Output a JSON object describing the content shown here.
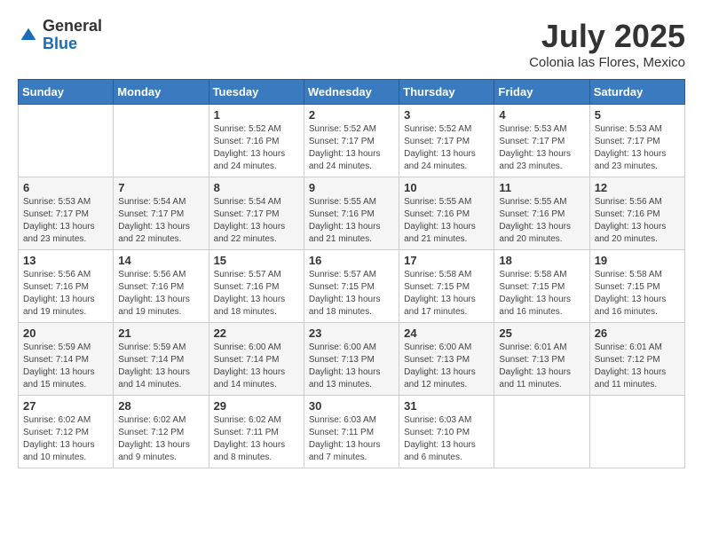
{
  "logo": {
    "general": "General",
    "blue": "Blue"
  },
  "title": "July 2025",
  "subtitle": "Colonia las Flores, Mexico",
  "days_of_week": [
    "Sunday",
    "Monday",
    "Tuesday",
    "Wednesday",
    "Thursday",
    "Friday",
    "Saturday"
  ],
  "weeks": [
    [
      {
        "day": "",
        "content": ""
      },
      {
        "day": "",
        "content": ""
      },
      {
        "day": "1",
        "content": "Sunrise: 5:52 AM\nSunset: 7:16 PM\nDaylight: 13 hours and 24 minutes."
      },
      {
        "day": "2",
        "content": "Sunrise: 5:52 AM\nSunset: 7:17 PM\nDaylight: 13 hours and 24 minutes."
      },
      {
        "day": "3",
        "content": "Sunrise: 5:52 AM\nSunset: 7:17 PM\nDaylight: 13 hours and 24 minutes."
      },
      {
        "day": "4",
        "content": "Sunrise: 5:53 AM\nSunset: 7:17 PM\nDaylight: 13 hours and 23 minutes."
      },
      {
        "day": "5",
        "content": "Sunrise: 5:53 AM\nSunset: 7:17 PM\nDaylight: 13 hours and 23 minutes."
      }
    ],
    [
      {
        "day": "6",
        "content": "Sunrise: 5:53 AM\nSunset: 7:17 PM\nDaylight: 13 hours and 23 minutes."
      },
      {
        "day": "7",
        "content": "Sunrise: 5:54 AM\nSunset: 7:17 PM\nDaylight: 13 hours and 22 minutes."
      },
      {
        "day": "8",
        "content": "Sunrise: 5:54 AM\nSunset: 7:17 PM\nDaylight: 13 hours and 22 minutes."
      },
      {
        "day": "9",
        "content": "Sunrise: 5:55 AM\nSunset: 7:16 PM\nDaylight: 13 hours and 21 minutes."
      },
      {
        "day": "10",
        "content": "Sunrise: 5:55 AM\nSunset: 7:16 PM\nDaylight: 13 hours and 21 minutes."
      },
      {
        "day": "11",
        "content": "Sunrise: 5:55 AM\nSunset: 7:16 PM\nDaylight: 13 hours and 20 minutes."
      },
      {
        "day": "12",
        "content": "Sunrise: 5:56 AM\nSunset: 7:16 PM\nDaylight: 13 hours and 20 minutes."
      }
    ],
    [
      {
        "day": "13",
        "content": "Sunrise: 5:56 AM\nSunset: 7:16 PM\nDaylight: 13 hours and 19 minutes."
      },
      {
        "day": "14",
        "content": "Sunrise: 5:56 AM\nSunset: 7:16 PM\nDaylight: 13 hours and 19 minutes."
      },
      {
        "day": "15",
        "content": "Sunrise: 5:57 AM\nSunset: 7:16 PM\nDaylight: 13 hours and 18 minutes."
      },
      {
        "day": "16",
        "content": "Sunrise: 5:57 AM\nSunset: 7:15 PM\nDaylight: 13 hours and 18 minutes."
      },
      {
        "day": "17",
        "content": "Sunrise: 5:58 AM\nSunset: 7:15 PM\nDaylight: 13 hours and 17 minutes."
      },
      {
        "day": "18",
        "content": "Sunrise: 5:58 AM\nSunset: 7:15 PM\nDaylight: 13 hours and 16 minutes."
      },
      {
        "day": "19",
        "content": "Sunrise: 5:58 AM\nSunset: 7:15 PM\nDaylight: 13 hours and 16 minutes."
      }
    ],
    [
      {
        "day": "20",
        "content": "Sunrise: 5:59 AM\nSunset: 7:14 PM\nDaylight: 13 hours and 15 minutes."
      },
      {
        "day": "21",
        "content": "Sunrise: 5:59 AM\nSunset: 7:14 PM\nDaylight: 13 hours and 14 minutes."
      },
      {
        "day": "22",
        "content": "Sunrise: 6:00 AM\nSunset: 7:14 PM\nDaylight: 13 hours and 14 minutes."
      },
      {
        "day": "23",
        "content": "Sunrise: 6:00 AM\nSunset: 7:13 PM\nDaylight: 13 hours and 13 minutes."
      },
      {
        "day": "24",
        "content": "Sunrise: 6:00 AM\nSunset: 7:13 PM\nDaylight: 13 hours and 12 minutes."
      },
      {
        "day": "25",
        "content": "Sunrise: 6:01 AM\nSunset: 7:13 PM\nDaylight: 13 hours and 11 minutes."
      },
      {
        "day": "26",
        "content": "Sunrise: 6:01 AM\nSunset: 7:12 PM\nDaylight: 13 hours and 11 minutes."
      }
    ],
    [
      {
        "day": "27",
        "content": "Sunrise: 6:02 AM\nSunset: 7:12 PM\nDaylight: 13 hours and 10 minutes."
      },
      {
        "day": "28",
        "content": "Sunrise: 6:02 AM\nSunset: 7:12 PM\nDaylight: 13 hours and 9 minutes."
      },
      {
        "day": "29",
        "content": "Sunrise: 6:02 AM\nSunset: 7:11 PM\nDaylight: 13 hours and 8 minutes."
      },
      {
        "day": "30",
        "content": "Sunrise: 6:03 AM\nSunset: 7:11 PM\nDaylight: 13 hours and 7 minutes."
      },
      {
        "day": "31",
        "content": "Sunrise: 6:03 AM\nSunset: 7:10 PM\nDaylight: 13 hours and 6 minutes."
      },
      {
        "day": "",
        "content": ""
      },
      {
        "day": "",
        "content": ""
      }
    ]
  ]
}
